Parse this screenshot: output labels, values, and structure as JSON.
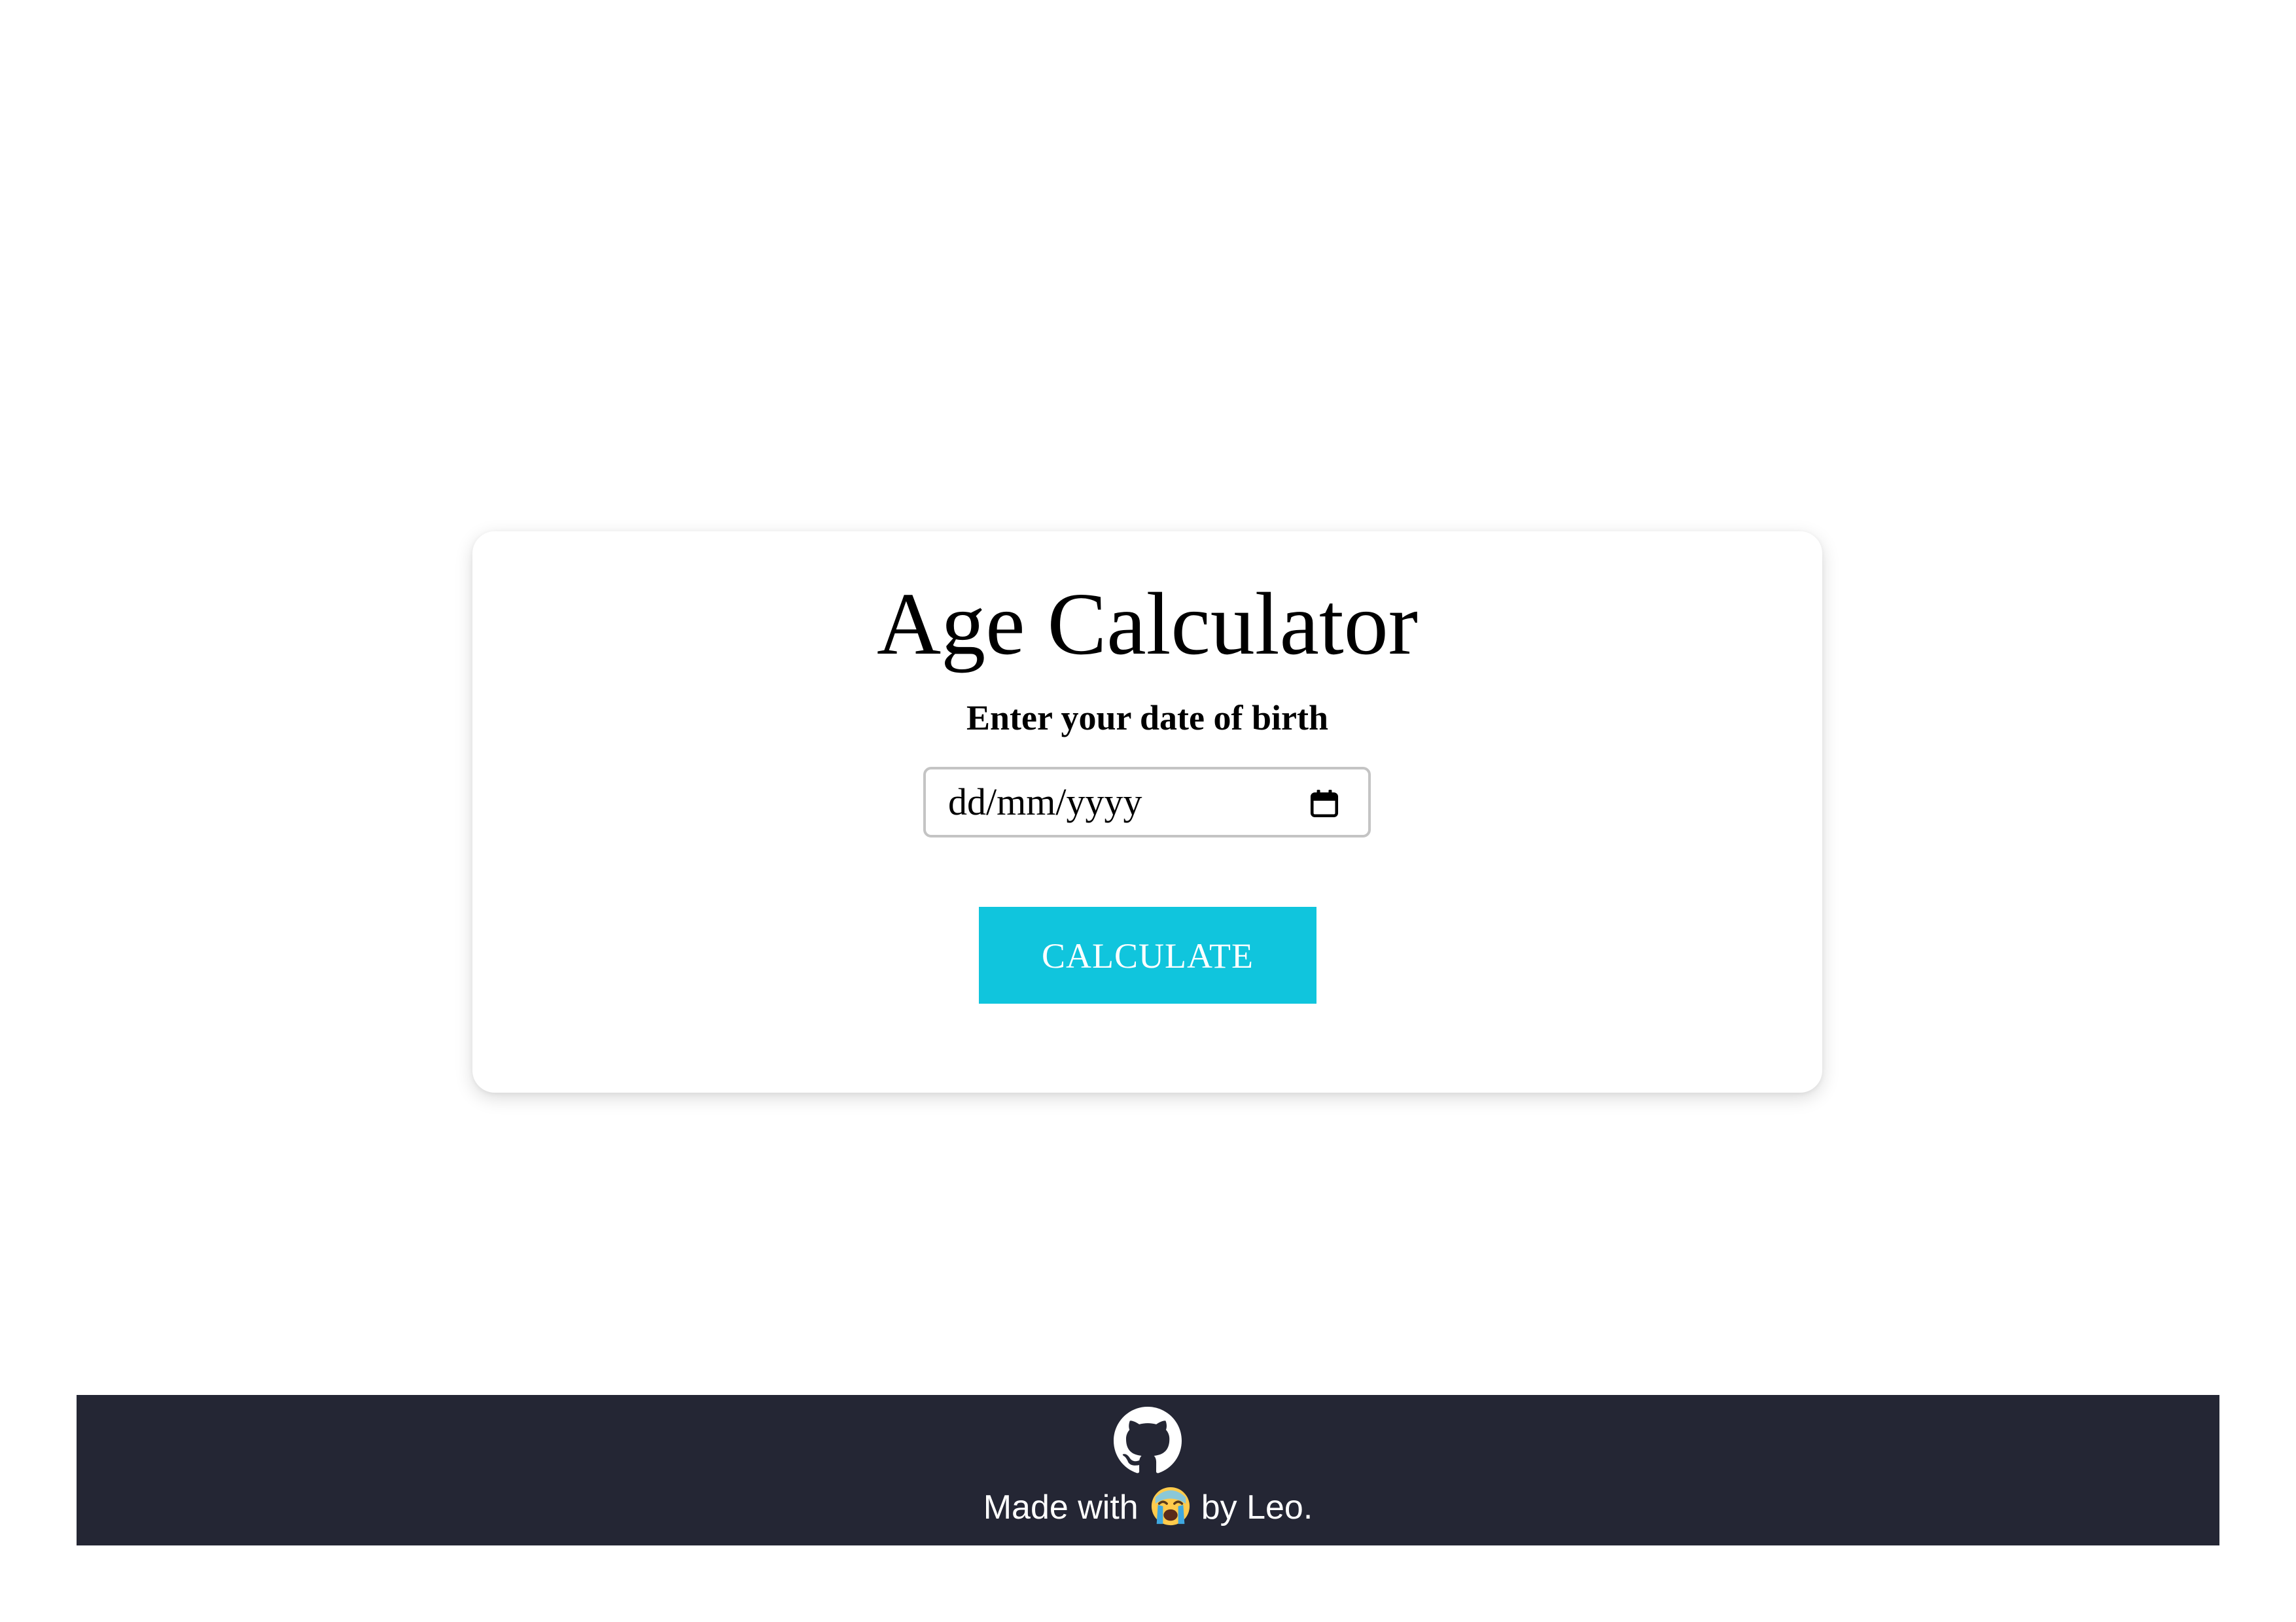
{
  "card": {
    "title": "Age Calculator",
    "subtitle": "Enter your date of birth",
    "date_input": {
      "placeholder": "dd/mm/yyyy",
      "icon": "calendar-icon"
    },
    "calculate_button_label": "CALCULATE"
  },
  "footer": {
    "github_icon": "github-icon",
    "made_with": "Made with",
    "emoji_icon": "crying-face-icon",
    "by": "by Leo."
  },
  "colors": {
    "accent": "#10c5dd",
    "footer_background": "#242634",
    "input_border": "#c4c4c4"
  }
}
